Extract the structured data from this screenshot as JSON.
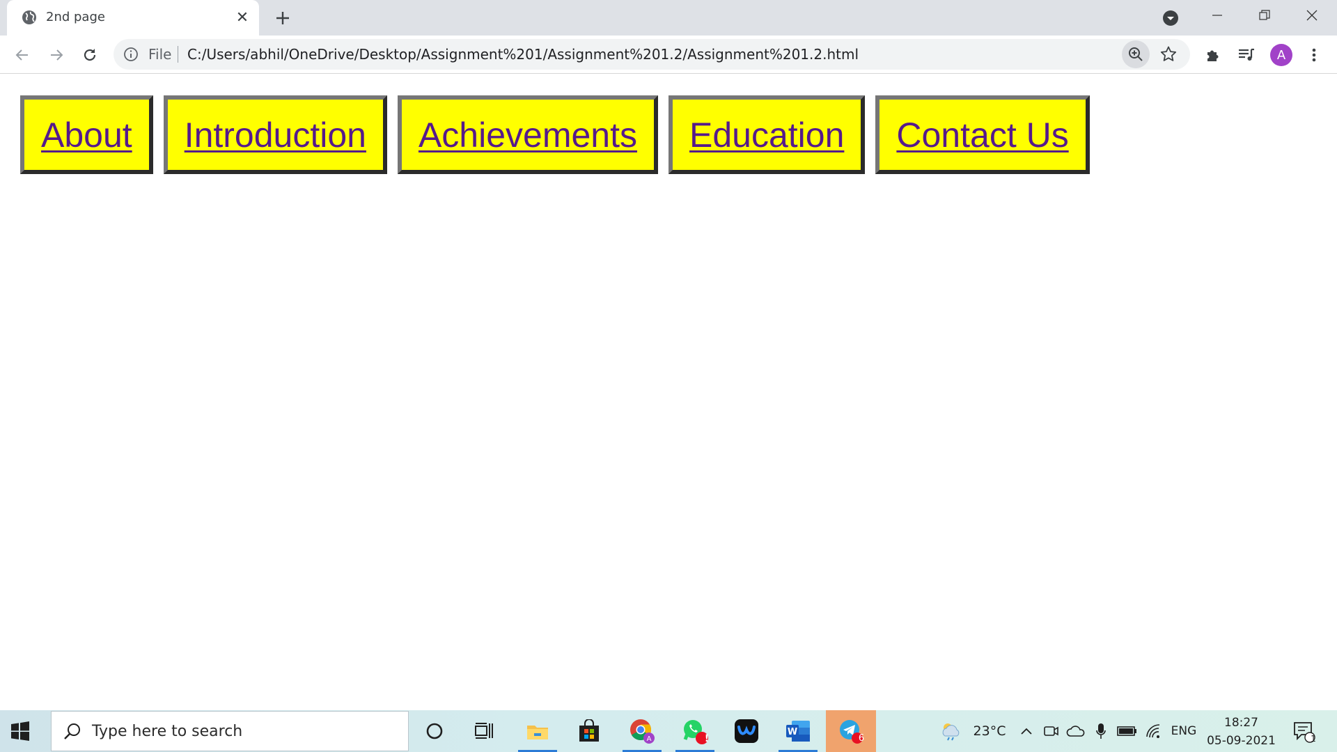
{
  "browser": {
    "tab_title": "2nd page",
    "omnibox_scheme_label": "File",
    "url": "C:/Users/abhil/OneDrive/Desktop/Assignment%201/Assignment%201.2/Assignment%201.2.html",
    "profile_initial": "A"
  },
  "page": {
    "nav_links": [
      {
        "label": "About"
      },
      {
        "label": "Introduction"
      },
      {
        "label": "Achievements"
      },
      {
        "label": "Education"
      },
      {
        "label": "Contact Us"
      }
    ],
    "nav_bg_color": "#ffff00",
    "link_color": "#551a8b"
  },
  "taskbar": {
    "search_placeholder": "Type here to search",
    "weather_temp": "23°C",
    "language": "ENG",
    "time": "18:27",
    "date": "05-09-2021",
    "whatsapp_badge": "!",
    "telegram_badge": "6",
    "notifications_count": "1"
  }
}
